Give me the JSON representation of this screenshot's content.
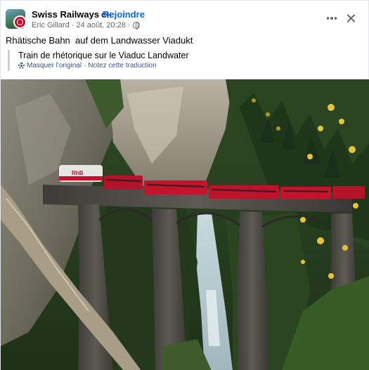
{
  "post": {
    "page_name": "Swiss Railways",
    "page_suffix": "CH",
    "separator": "·",
    "join_label": "Rejoindre",
    "author": "Eric Gillard",
    "date": "24 août, 20:28",
    "meta_separator": "·",
    "text": "Rhätische Bahn  auf dem Landwasser Viadukt",
    "translation": "Train de rhétorique sur le Viaduc Landwater",
    "hide_original_label": "Masquer l'original",
    "actions_separator": "·",
    "rate_translation_label": "Notez cette traduction",
    "photo_train_text": "RhB"
  },
  "icons": {
    "more": "more-horizontal-icon",
    "close": "close-icon",
    "privacy": "globe-icon",
    "translation": "gear-icon"
  },
  "colors": {
    "link_blue": "#0866ff",
    "translation_link": "#385898",
    "secondary_text": "#65676b",
    "train_red": "#c8102e"
  }
}
